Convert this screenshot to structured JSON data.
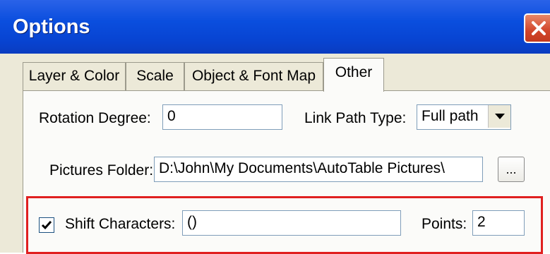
{
  "window": {
    "title": "Options"
  },
  "tabs": [
    {
      "label": "Layer & Color"
    },
    {
      "label": "Scale"
    },
    {
      "label": "Object & Font Map"
    },
    {
      "label": "Other"
    }
  ],
  "rotation": {
    "label": "Rotation Degree:",
    "value": "0"
  },
  "link_path": {
    "label": "Link Path Type:",
    "value": "Full path"
  },
  "pictures": {
    "label": "Pictures Folder:",
    "value": "D:\\John\\My Documents\\AutoTable Pictures\\",
    "browse_label": "..."
  },
  "shift": {
    "label": "Shift Characters:",
    "value": "()",
    "checked": true
  },
  "points": {
    "label": "Points:",
    "value": "2"
  },
  "colors": {
    "title_bar": "#0a4ede",
    "highlight": "#e02020",
    "close": "#d2452a"
  }
}
